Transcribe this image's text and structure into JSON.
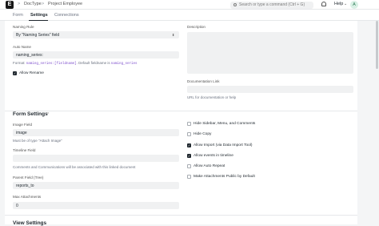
{
  "topbar": {
    "logo": "E",
    "breadcrumb": [
      "DocType",
      "Project Employee"
    ],
    "breadcrumb_sep": ">",
    "search_placeholder": "Search or type a command (Ctrl + G)",
    "help_label": "Help",
    "avatar_initial": "A"
  },
  "tabs": [
    "Form",
    "Settings",
    "Connections"
  ],
  "active_tab": "Settings",
  "naming": {
    "naming_rule_label": "Naming Rule",
    "naming_rule_value": "By \"Naming Series\" field",
    "auto_name_label": "Auto Name",
    "auto_name_value": "naming_series:",
    "format_prefix": "Format:",
    "format_code": "naming_series:[fieldname]",
    "format_mid": ". Default fieldname is",
    "format_default": "naming_series",
    "allow_rename_label": "Allow Rename",
    "allow_rename_checked": true,
    "description_label": "Description",
    "doc_link_label": "Documentation Link",
    "doc_link_hint": "URL for documentation or help"
  },
  "form_settings": {
    "title": "Form Settings",
    "image_field_label": "Image Field",
    "image_field_value": "image",
    "image_field_hint": "Must be of type \"Attach Image\"",
    "timeline_field_label": "Timeline Field",
    "timeline_hint": "Comments and Communications will be associated with this linked document",
    "parent_field_label": "Parent Field (Tree)",
    "parent_field_value": "reports_to",
    "max_attachments_label": "Max Attachments",
    "max_attachments_value": "0",
    "options": [
      {
        "label": "Hide Sidebar, Menu, and Comments",
        "checked": false
      },
      {
        "label": "Hide Copy",
        "checked": false
      },
      {
        "label": "Allow Import (via Data Import Tool)",
        "checked": true
      },
      {
        "label": "Allow events in timeline",
        "checked": true
      },
      {
        "label": "Allow Auto Repeat",
        "checked": false
      },
      {
        "label": "Make Attachments Public by Default",
        "checked": false
      }
    ]
  },
  "view_settings": {
    "title": "View Settings"
  }
}
